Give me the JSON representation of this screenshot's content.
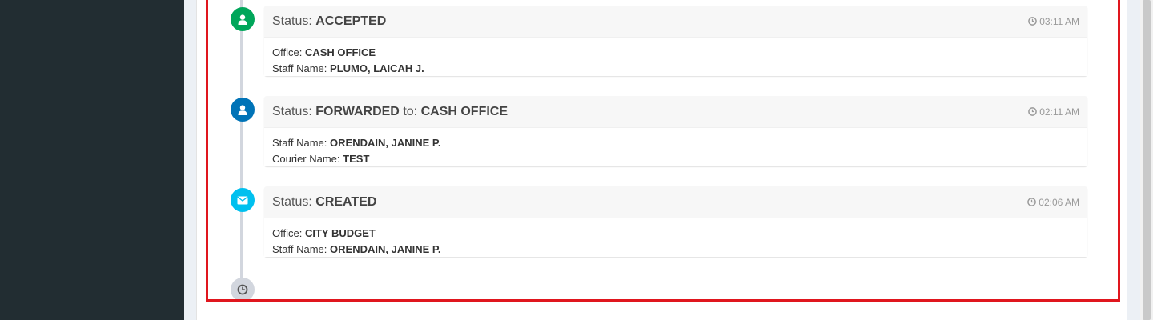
{
  "timeline": {
    "items": [
      {
        "status_label": "Status:",
        "status_value": "ACCEPTED",
        "time": "03:11 AM",
        "icon": "user-icon",
        "color": "#00a65a",
        "field1_label": "Office:",
        "field1_value": "CASH OFFICE",
        "field2_label": "Staff Name:",
        "field2_value": "PLUMO, LAICAH J."
      },
      {
        "status_label": "Status:",
        "status_value": "FORWARDED",
        "to_label": "to:",
        "to_value": "CASH OFFICE",
        "time": "02:11 AM",
        "icon": "user-icon",
        "color": "#0073b7",
        "field1_label": "Staff Name:",
        "field1_value": "ORENDAIN, JANINE P.",
        "field2_label": "Courier Name:",
        "field2_value": "TEST"
      },
      {
        "status_label": "Status:",
        "status_value": "CREATED",
        "time": "02:06 AM",
        "icon": "envelope-icon",
        "color": "#00c0ef",
        "field1_label": "Office:",
        "field1_value": "CITY BUDGET",
        "field2_label": "Staff Name:",
        "field2_value": "ORENDAIN, JANINE P."
      }
    ],
    "end_icon": "clock-icon"
  }
}
